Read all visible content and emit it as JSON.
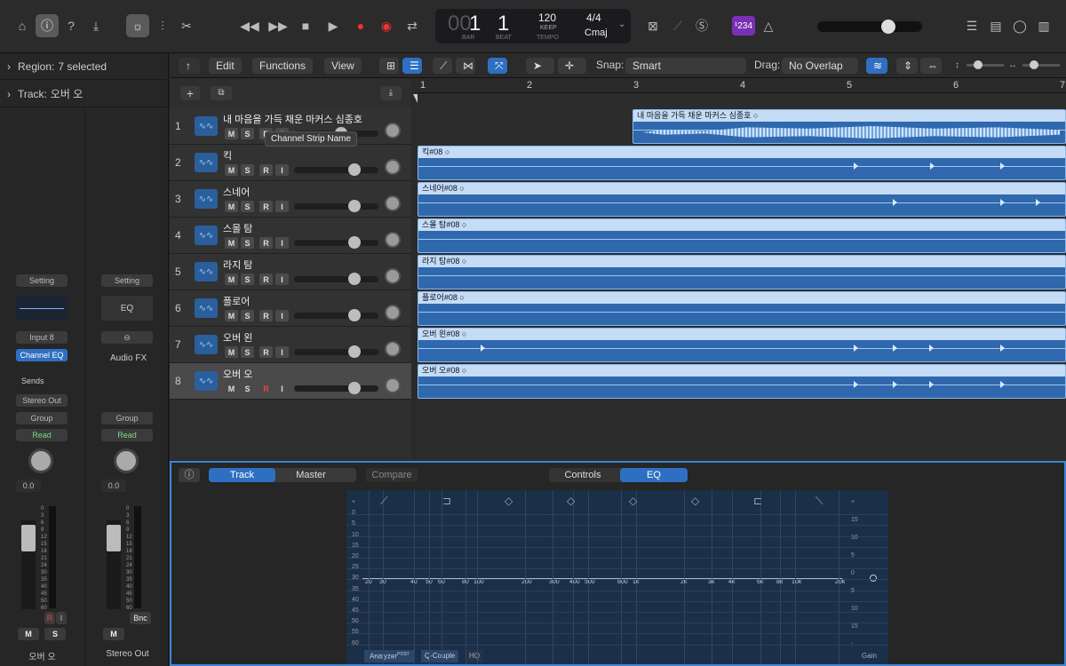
{
  "transport": {
    "bar": "1",
    "beat": "1",
    "bar_label": "BAR",
    "beat_label": "BEAT",
    "tempo": "120",
    "keep": "KEEP",
    "tempo_label": "TEMPO",
    "signature": "4/4",
    "key": "Cmaj",
    "lcd_dim": "00",
    "counter": "¹234"
  },
  "inspector": {
    "region_label": "Region:",
    "region_value": "7 selected",
    "track_label": "Track:",
    "track_value": "오버 오"
  },
  "strip1": {
    "setting": "Setting",
    "input": "Input 8",
    "eq": "Channel EQ",
    "sends": "Sends",
    "output": "Stereo Out",
    "group": "Group",
    "read": "Read",
    "value": "0.0",
    "r": "R",
    "i": "I",
    "m": "M",
    "s": "S",
    "name": "오버 오"
  },
  "strip2": {
    "setting": "Setting",
    "eq": "EQ",
    "fx": "Audio FX",
    "group": "Group",
    "read": "Read",
    "value": "0.0",
    "bnc": "Bnc",
    "m": "M",
    "name": "Stereo Out"
  },
  "fader_scale": [
    "0",
    "3",
    "6",
    "9",
    "12",
    "15",
    "18",
    "21",
    "24",
    "30",
    "35",
    "40",
    "45",
    "50",
    "60"
  ],
  "toolbar": {
    "edit": "Edit",
    "functions": "Functions",
    "view": "View",
    "snap_label": "Snap:",
    "snap_value": "Smart",
    "drag_label": "Drag:",
    "drag_value": "No Overlap"
  },
  "ruler": [
    "1",
    "2",
    "3",
    "4",
    "5",
    "6",
    "7"
  ],
  "tooltip": "Channel Strip Name",
  "tracks": [
    {
      "num": "1",
      "name": "내 마음을 가득 채운 마커스 심종호",
      "m": "M",
      "s": "S",
      "r": "R",
      "i": "I",
      "region": "내 마음을 가득 채운 마커스 심종호"
    },
    {
      "num": "2",
      "name": "킥",
      "m": "M",
      "s": "S",
      "r": "R",
      "i": "I",
      "region": "킥#08"
    },
    {
      "num": "3",
      "name": "스네어",
      "m": "M",
      "s": "S",
      "r": "R",
      "i": "I",
      "region": "스네어#08"
    },
    {
      "num": "4",
      "name": "스몰 탐",
      "m": "M",
      "s": "S",
      "r": "R",
      "i": "I",
      "region": "스몰 탐#08"
    },
    {
      "num": "5",
      "name": "라지 탐",
      "m": "M",
      "s": "S",
      "r": "R",
      "i": "I",
      "region": "라지 탐#08"
    },
    {
      "num": "6",
      "name": "플로어",
      "m": "M",
      "s": "S",
      "r": "R",
      "i": "I",
      "region": "플로어#08"
    },
    {
      "num": "7",
      "name": "오버 왼",
      "m": "M",
      "s": "S",
      "r": "R",
      "i": "I",
      "region": "오버 왼#08"
    },
    {
      "num": "8",
      "name": "오버 오",
      "m": "M",
      "s": "S",
      "r": "R",
      "i": "I",
      "region": "오버 오#08"
    }
  ],
  "eq": {
    "track": "Track",
    "master": "Master",
    "compare": "Compare",
    "controls": "Controls",
    "eq": "EQ",
    "analyzer": "Analyzer",
    "post": "POST",
    "qcouple": "Q-Couple",
    "hq": "HQ",
    "gain": "Gain",
    "freqs": [
      "20",
      "30",
      "40",
      "50",
      "60",
      "80",
      "100",
      "200",
      "300",
      "400",
      "500",
      "800",
      "1k",
      "2k",
      "3k",
      "4k",
      "6k",
      "8k",
      "10k",
      "20k"
    ],
    "db_left": [
      "+",
      "0",
      "5",
      "10",
      "15",
      "20",
      "25",
      "30",
      "35",
      "40",
      "45",
      "50",
      "55",
      "60"
    ],
    "db_right": [
      "+",
      "15",
      "10",
      "5",
      "0",
      "5",
      "10",
      "15",
      "-"
    ]
  }
}
